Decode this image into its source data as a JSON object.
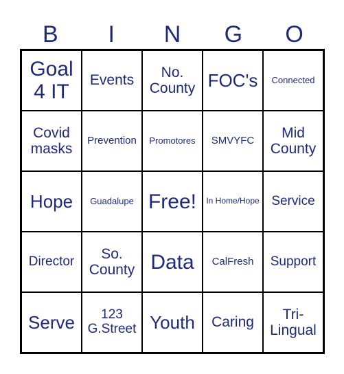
{
  "header": {
    "letters": [
      "B",
      "I",
      "N",
      "G",
      "O"
    ]
  },
  "colors": {
    "text": "#1e2a78",
    "grid": "#000000",
    "background": "#ffffff"
  },
  "board": {
    "rows": [
      [
        {
          "text": "Goal 4 IT",
          "size": "s-xl"
        },
        {
          "text": "Events",
          "size": "s-m"
        },
        {
          "text": "No. County",
          "size": "s-m"
        },
        {
          "text": "FOC's",
          "size": "s-l"
        },
        {
          "text": "Connected",
          "size": "s-xs"
        }
      ],
      [
        {
          "text": "Covid masks",
          "size": "s-m"
        },
        {
          "text": "Prevention",
          "size": "s-s"
        },
        {
          "text": "Promotores",
          "size": "s-xs"
        },
        {
          "text": "SMVYFC",
          "size": "s-s"
        },
        {
          "text": "Mid County",
          "size": "s-m"
        }
      ],
      [
        {
          "text": "Hope",
          "size": "s-l"
        },
        {
          "text": "Guadalupe",
          "size": "s-xs"
        },
        {
          "text": "Free!",
          "size": "s-xl"
        },
        {
          "text": "In Home/Hope",
          "size": "s-xxs"
        },
        {
          "text": "Service",
          "size": "s-sm"
        }
      ],
      [
        {
          "text": "Director",
          "size": "s-sm"
        },
        {
          "text": "So. County",
          "size": "s-m"
        },
        {
          "text": "Data",
          "size": "s-xl"
        },
        {
          "text": "CalFresh",
          "size": "s-s"
        },
        {
          "text": "Support",
          "size": "s-sm"
        }
      ],
      [
        {
          "text": "Serve",
          "size": "s-l"
        },
        {
          "text": "123 G.Street",
          "size": "s-sm"
        },
        {
          "text": "Youth",
          "size": "s-l"
        },
        {
          "text": "Caring",
          "size": "s-m"
        },
        {
          "text": "Tri-Lingual",
          "size": "s-m"
        }
      ]
    ]
  }
}
